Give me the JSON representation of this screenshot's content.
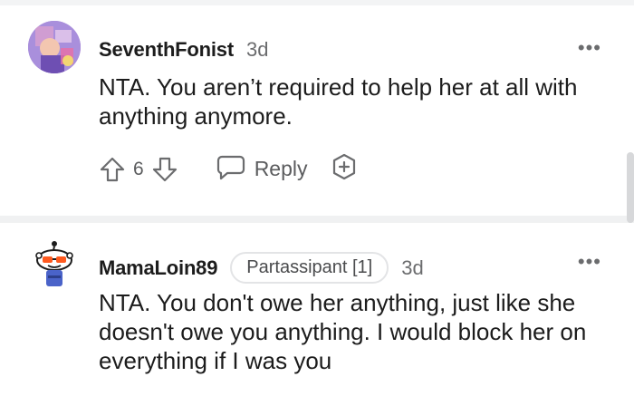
{
  "comments": [
    {
      "username": "SeventhFonist",
      "age": "3d",
      "more": "•••",
      "body": "NTA. You aren’t required to help her at all with anything anymore.",
      "votes": "6",
      "reply_label": "Reply"
    },
    {
      "username": "MamaLoin89",
      "flair": "Partassipant [1]",
      "age": "3d",
      "more": "•••",
      "body": "NTA. You don't owe her anything, just like she doesn't owe you anything. I would block her on everything if I was you"
    }
  ],
  "icons": {
    "upvote": "upvote-arrow-icon",
    "downvote": "downvote-arrow-icon",
    "reply": "speech-bubble-icon",
    "award": "award-plus-icon",
    "more": "more-options-icon"
  },
  "colors": {
    "text": "#1c1c1c",
    "muted": "#6b6c6e",
    "divider": "#f0f1f2"
  }
}
